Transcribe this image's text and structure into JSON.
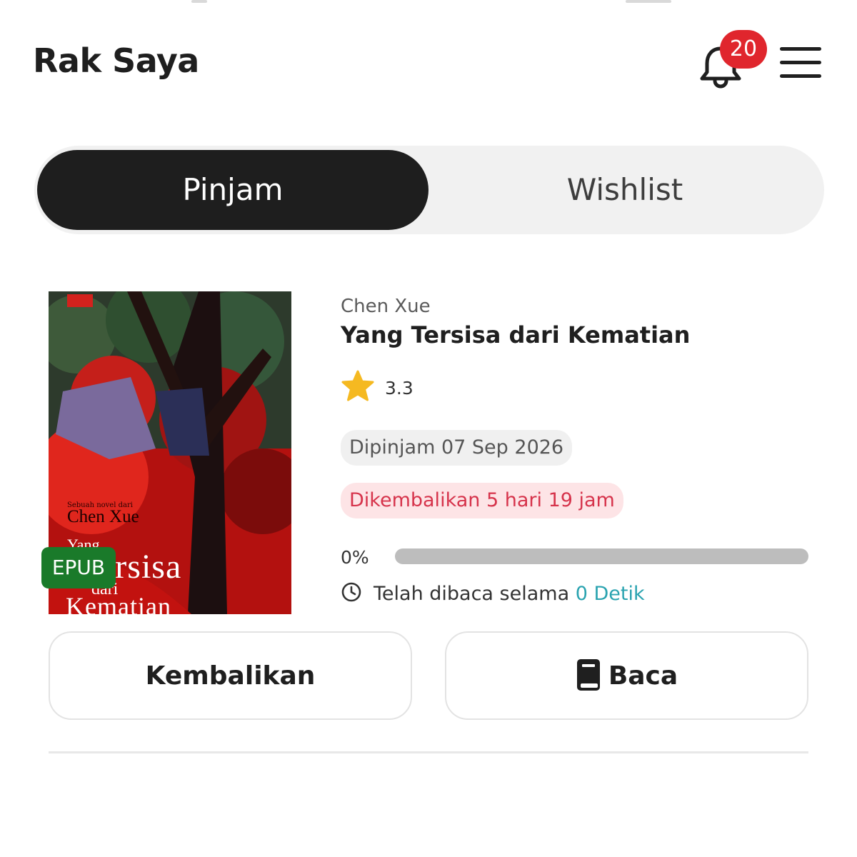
{
  "header": {
    "title": "Rak Saya",
    "notification_count": "20",
    "bell_icon": "bell-icon",
    "menu_icon": "hamburger-menu-icon"
  },
  "tabs": [
    {
      "label": "Pinjam",
      "active": true
    },
    {
      "label": "Wishlist",
      "active": false
    }
  ],
  "book": {
    "author": "Chen Xue",
    "title": "Yang Tersisa dari Kematian",
    "rating": "3.3",
    "borrowed_label": "Dipinjam 07 Sep 2026",
    "due_label": "Dikembalikan 5 hari 19 jam",
    "progress_label": "0%",
    "progress_value": 0,
    "read_time_prefix": "Telah dibaca selama",
    "read_time_value": "0 Detik",
    "format": "EPUB",
    "cover": {
      "tagline": "Sebuah novel dari",
      "author": "Chen Xue",
      "title_line1": "Yang",
      "title_line2": "Tersisa",
      "title_line3": "dari",
      "title_line4": "Kematian"
    }
  },
  "actions": {
    "return_label": "Kembalikan",
    "read_label": "Baca",
    "read_icon": "book-icon"
  },
  "colors": {
    "accent_red": "#e0262d",
    "format_green": "#1a7a2a",
    "due_text": "#d6334b",
    "due_bg": "#fde4e6",
    "link_teal": "#2aa3b0",
    "star": "#f5b921"
  }
}
